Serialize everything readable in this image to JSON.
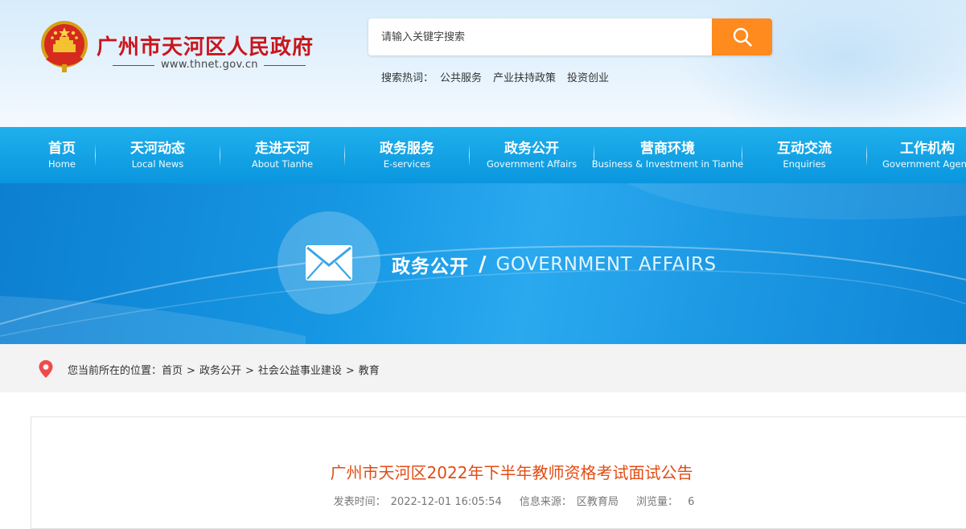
{
  "header": {
    "site_title": "广州市天河区人民政府",
    "site_url": "www.thnet.gov.cn",
    "search_placeholder": "请输入关键字搜索",
    "hot_label": "搜索热词：",
    "hot_words": [
      "公共服务",
      "产业扶持政策",
      "投资创业"
    ]
  },
  "nav": [
    {
      "cn": "首页",
      "en": "Home"
    },
    {
      "cn": "天河动态",
      "en": "Local News"
    },
    {
      "cn": "走进天河",
      "en": "About Tianhe"
    },
    {
      "cn": "政务服务",
      "en": "E-services"
    },
    {
      "cn": "政务公开",
      "en": "Government Affairs"
    },
    {
      "cn": "营商环境",
      "en": "Business & Investment in Tianhe"
    },
    {
      "cn": "互动交流",
      "en": "Enquiries"
    },
    {
      "cn": "工作机构",
      "en": "Government Agencies"
    }
  ],
  "banner": {
    "title_cn": "政务公开",
    "slash": "/",
    "title_en": "GOVERNMENT AFFAIRS"
  },
  "breadcrumb": {
    "label": "您当前所在的位置：",
    "items": [
      "首页",
      "政务公开",
      "社会公益事业建设",
      "教育"
    ],
    "separator": ">"
  },
  "article": {
    "title": "广州市天河区2022年下半年教师资格考试面试公告",
    "publish_label": "发表时间：",
    "publish_time": "2022-12-01 16:05:54",
    "source_label": "信息来源：",
    "source": "区教育局",
    "views_label": "浏览量：",
    "views": "6"
  },
  "colors": {
    "brand_red": "#c8161d",
    "nav_blue": "#0a96de",
    "search_orange": "#ff8a1e",
    "article_title": "#e24c14"
  },
  "icons": [
    "national-emblem-icon",
    "search-icon",
    "envelope-icon",
    "location-pin-icon"
  ]
}
